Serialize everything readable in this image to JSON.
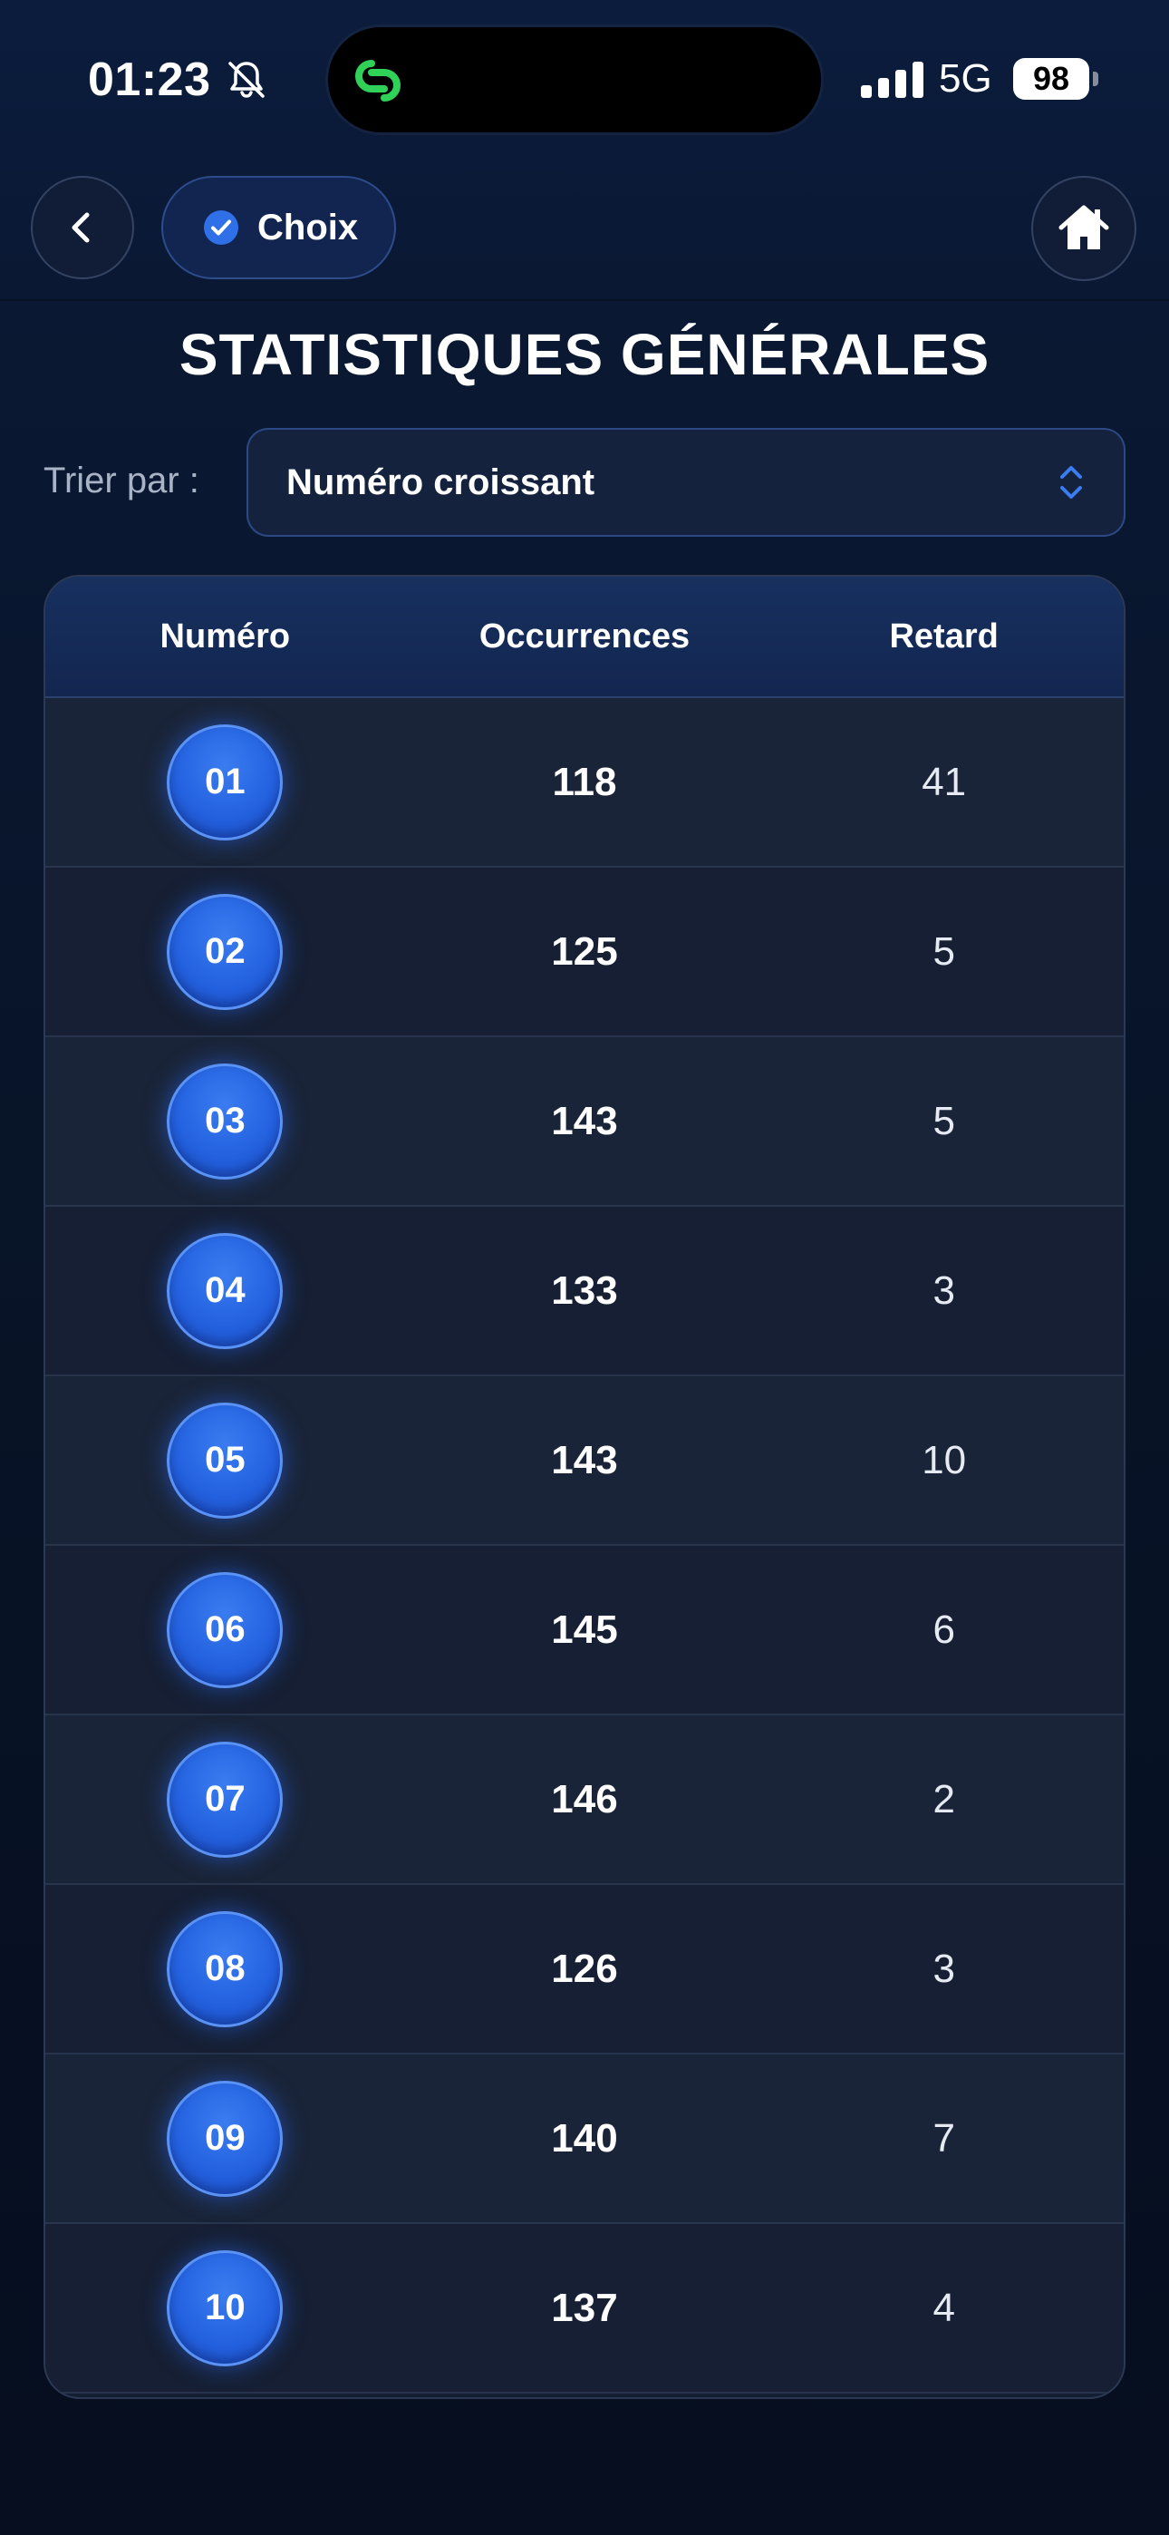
{
  "status_bar": {
    "time": "01:23",
    "network": "5G",
    "battery": "98",
    "icons": [
      "bell-slash-icon",
      "link-app-icon",
      "cellular-signal-icon",
      "battery-icon"
    ]
  },
  "nav": {
    "back_icon": "chevron-left-icon",
    "chip_label": "Choix",
    "chip_icon": "check-circle-icon",
    "home_icon": "home-icon"
  },
  "page": {
    "title": "STATISTIQUES GÉNÉRALES"
  },
  "sort": {
    "label": "Trier par :",
    "value": "Numéro croissant",
    "icon": "chevron-up-down-icon"
  },
  "table": {
    "headers": {
      "number": "Numéro",
      "occurrences": "Occurrences",
      "delay": "Retard"
    },
    "rows": [
      {
        "number": "01",
        "occurrences": "118",
        "delay": "41"
      },
      {
        "number": "02",
        "occurrences": "125",
        "delay": "5"
      },
      {
        "number": "03",
        "occurrences": "143",
        "delay": "5"
      },
      {
        "number": "04",
        "occurrences": "133",
        "delay": "3"
      },
      {
        "number": "05",
        "occurrences": "143",
        "delay": "10"
      },
      {
        "number": "06",
        "occurrences": "145",
        "delay": "6"
      },
      {
        "number": "07",
        "occurrences": "146",
        "delay": "2"
      },
      {
        "number": "08",
        "occurrences": "126",
        "delay": "3"
      },
      {
        "number": "09",
        "occurrences": "140",
        "delay": "7"
      },
      {
        "number": "10",
        "occurrences": "137",
        "delay": "4"
      }
    ]
  },
  "colors": {
    "accent": "#2462e0",
    "background": "#081428",
    "island_icon": "#30d158"
  }
}
